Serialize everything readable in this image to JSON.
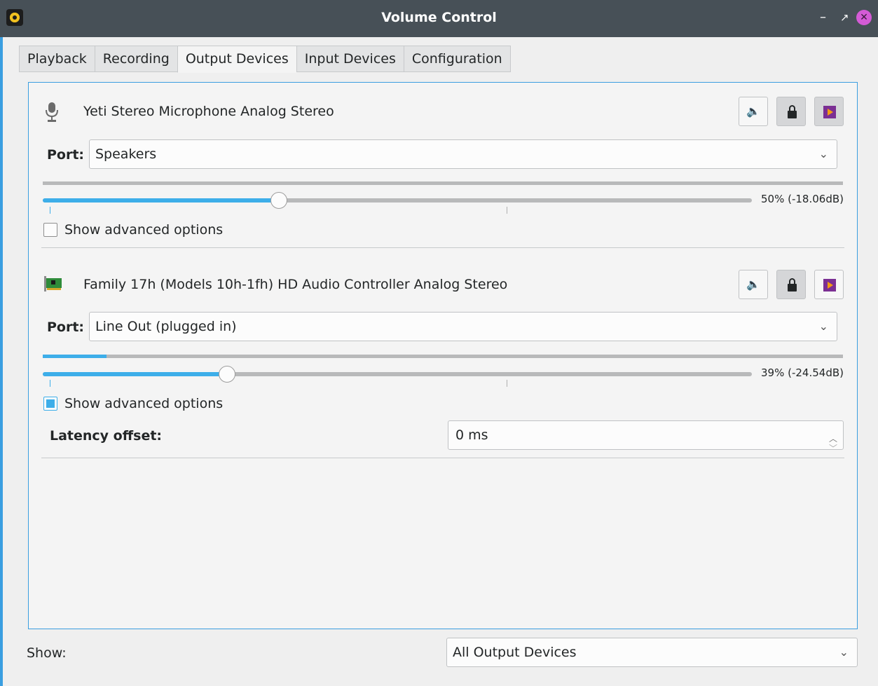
{
  "window": {
    "title": "Volume Control",
    "minimize": "–",
    "maximize": "↗",
    "close": "✕"
  },
  "tabs": [
    {
      "label": "Playback"
    },
    {
      "label": "Recording"
    },
    {
      "label": "Output Devices",
      "active": true
    },
    {
      "label": "Input Devices"
    },
    {
      "label": "Configuration"
    }
  ],
  "devices": [
    {
      "name": "Yeti Stereo Microphone Analog Stereo",
      "icon": "microphone-icon",
      "port_label": "Port:",
      "port_value": "Speakers",
      "volume_percent": 50,
      "volume_label": "50% (-18.06dB)",
      "meter_level": 0,
      "advanced_label": "Show advanced options",
      "advanced_checked": false
    },
    {
      "name": "Family 17h (Models 10h-1fh) HD Audio Controller Analog Stereo",
      "icon": "sound-card-icon",
      "port_label": "Port:",
      "port_value": "Line Out (plugged in)",
      "volume_percent": 39,
      "volume_label": "39% (-24.54dB)",
      "meter_level": 0.08,
      "advanced_label": "Show advanced options",
      "advanced_checked": true,
      "latency_label": "Latency offset:",
      "latency_value": "0 ms"
    }
  ],
  "footer": {
    "show_label": "Show:",
    "show_value": "All Output Devices"
  },
  "colors": {
    "accent": "#3daee9",
    "titlebar": "#475057",
    "close": "#d45bd6"
  }
}
